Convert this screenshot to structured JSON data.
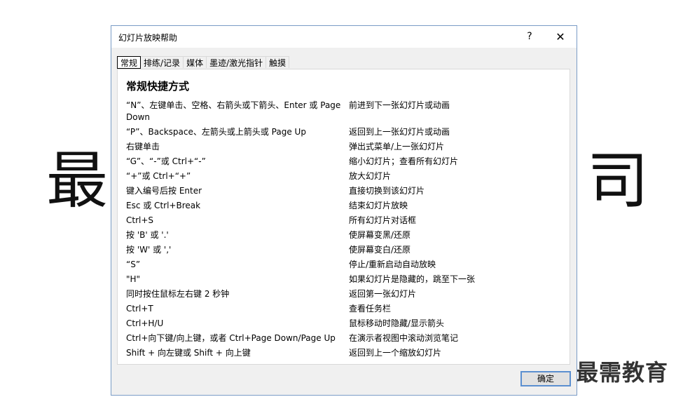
{
  "background": {
    "left_char": "最",
    "right_char": "司",
    "brand": "最需教育"
  },
  "dialog": {
    "title": "幻灯片放映帮助",
    "help_glyph": "?",
    "close_glyph": "✕",
    "ok_label": "确定"
  },
  "tabs": [
    "常规",
    "排练/记录",
    "媒体",
    "墨迹/激光指针",
    "触摸"
  ],
  "panel": {
    "heading": "常规快捷方式",
    "rows": [
      {
        "keys": "“N”、左键单击、空格、右箭头或下箭头、Enter 或 Page Down",
        "desc": "前进到下一张幻灯片或动画"
      },
      {
        "keys": "“P”、Backspace、左箭头或上箭头或 Page Up",
        "desc": "返回到上一张幻灯片或动画"
      },
      {
        "keys": "右键单击",
        "desc": "弹出式菜单/上一张幻灯片"
      },
      {
        "keys": "“G”、“-”或 Ctrl+“-”",
        "desc": "缩小幻灯片；查看所有幻灯片"
      },
      {
        "keys": "“+”或 Ctrl+“+”",
        "desc": "放大幻灯片"
      },
      {
        "keys": "键入编号后按 Enter",
        "desc": "直接切换到该幻灯片"
      },
      {
        "keys": "Esc 或 Ctrl+Break",
        "desc": "结束幻灯片放映"
      },
      {
        "keys": "Ctrl+S",
        "desc": "所有幻灯片对话框"
      },
      {
        "keys": "按 'B' 或 '.'",
        "desc": "使屏幕变黑/还原"
      },
      {
        "keys": "按 'W' 或 ','",
        "desc": "使屏幕变白/还原"
      },
      {
        "keys": "“S”",
        "desc": "停止/重新启动自动放映"
      },
      {
        "keys": "\"H\"",
        "desc": "如果幻灯片是隐藏的，跳至下一张"
      },
      {
        "keys": "同时按住鼠标左右键 2 秒钟",
        "desc": "返回第一张幻灯片"
      },
      {
        "keys": "Ctrl+T",
        "desc": "查看任务栏"
      },
      {
        "keys": "Ctrl+H/U",
        "desc": "鼠标移动时隐藏/显示箭头"
      },
      {
        "keys": "Ctrl+向下键/向上键，或者 Ctrl+Page Down/Page Up",
        "desc": "在演示者视图中滚动浏览笔记"
      },
      {
        "keys": "Shift + 向左键或 Shift + 向上键",
        "desc": "返回到上一个缩放幻灯片"
      }
    ]
  }
}
